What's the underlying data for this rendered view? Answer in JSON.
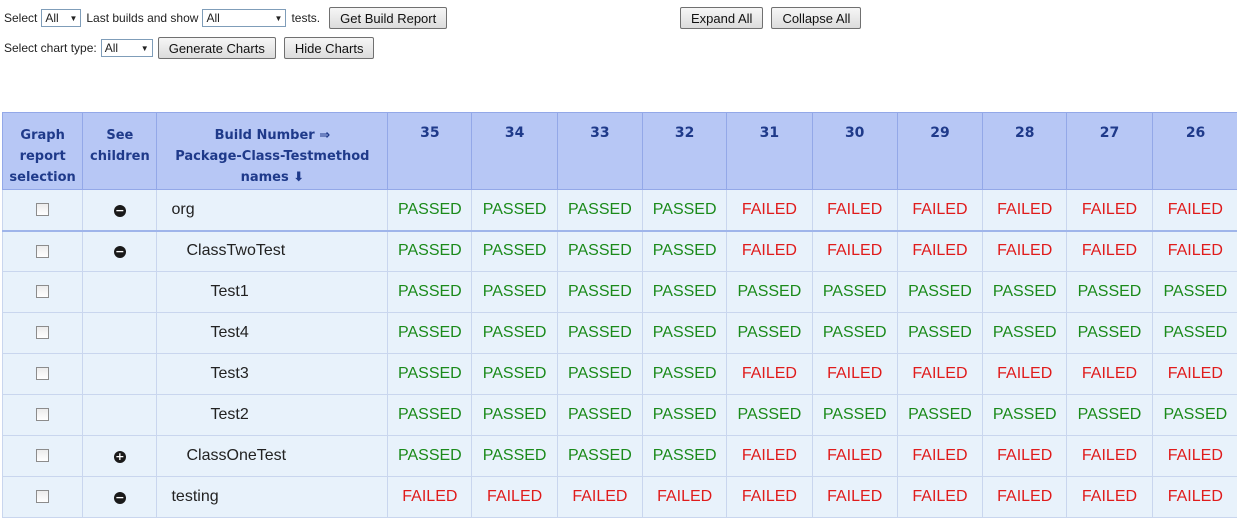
{
  "controls": {
    "select_label": "Select",
    "builds_value": "All",
    "last_builds_label": "Last builds and show",
    "show_value": "All",
    "tests_label": "tests.",
    "get_report_button": "Get Build Report",
    "expand_all_button": "Expand All",
    "collapse_all_button": "Collapse All",
    "chart_type_label": "Select chart type:",
    "chart_type_value": "All",
    "generate_charts_button": "Generate Charts",
    "hide_charts_button": "Hide Charts"
  },
  "table": {
    "headers": {
      "graph": [
        "Graph",
        "report",
        "selection"
      ],
      "children": [
        "See",
        "children"
      ],
      "build": [
        "Build Number ⇒",
        "Package-Class-Testmethod",
        "names ⬇"
      ]
    },
    "builds": [
      "35",
      "34",
      "33",
      "32",
      "31",
      "30",
      "29",
      "28",
      "27",
      "26"
    ],
    "rows": [
      {
        "name": "org",
        "level": 0,
        "toggle": "minus",
        "statuses": [
          "PASSED",
          "PASSED",
          "PASSED",
          "PASSED",
          "FAILED",
          "FAILED",
          "FAILED",
          "FAILED",
          "FAILED",
          "FAILED"
        ]
      },
      {
        "name": "ClassTwoTest",
        "level": 1,
        "toggle": "minus",
        "statuses": [
          "PASSED",
          "PASSED",
          "PASSED",
          "PASSED",
          "FAILED",
          "FAILED",
          "FAILED",
          "FAILED",
          "FAILED",
          "FAILED"
        ]
      },
      {
        "name": "Test1",
        "level": 2,
        "toggle": "",
        "statuses": [
          "PASSED",
          "PASSED",
          "PASSED",
          "PASSED",
          "PASSED",
          "PASSED",
          "PASSED",
          "PASSED",
          "PASSED",
          "PASSED"
        ]
      },
      {
        "name": "Test4",
        "level": 2,
        "toggle": "",
        "statuses": [
          "PASSED",
          "PASSED",
          "PASSED",
          "PASSED",
          "PASSED",
          "PASSED",
          "PASSED",
          "PASSED",
          "PASSED",
          "PASSED"
        ]
      },
      {
        "name": "Test3",
        "level": 2,
        "toggle": "",
        "statuses": [
          "PASSED",
          "PASSED",
          "PASSED",
          "PASSED",
          "FAILED",
          "FAILED",
          "FAILED",
          "FAILED",
          "FAILED",
          "FAILED"
        ]
      },
      {
        "name": "Test2",
        "level": 2,
        "toggle": "",
        "statuses": [
          "PASSED",
          "PASSED",
          "PASSED",
          "PASSED",
          "PASSED",
          "PASSED",
          "PASSED",
          "PASSED",
          "PASSED",
          "PASSED"
        ]
      },
      {
        "name": "ClassOneTest",
        "level": 1,
        "toggle": "plus",
        "statuses": [
          "PASSED",
          "PASSED",
          "PASSED",
          "PASSED",
          "FAILED",
          "FAILED",
          "FAILED",
          "FAILED",
          "FAILED",
          "FAILED"
        ]
      },
      {
        "name": "testing",
        "level": 0,
        "toggle": "minus",
        "statuses": [
          "FAILED",
          "FAILED",
          "FAILED",
          "FAILED",
          "FAILED",
          "FAILED",
          "FAILED",
          "FAILED",
          "FAILED",
          "FAILED"
        ]
      }
    ]
  },
  "colors": {
    "passed": "#1a8a1a",
    "failed": "#e01b1b",
    "header_bg": "#b7c7f5",
    "header_text": "#1f3a8a",
    "cell_bg": "#e8f2fb"
  },
  "icons": {
    "minus": "collapse-minus-icon",
    "plus": "expand-plus-icon",
    "dropdown": "chevron-down-icon"
  }
}
